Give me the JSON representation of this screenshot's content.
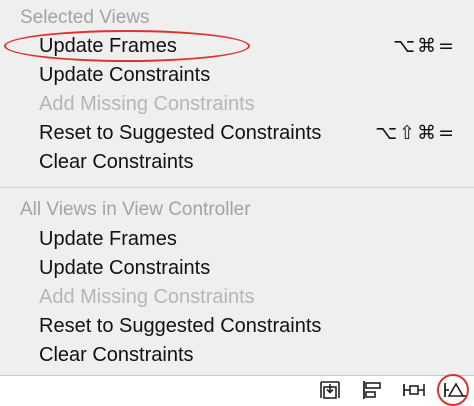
{
  "menu": {
    "selected_views": {
      "header": "Selected Views",
      "items": [
        {
          "label": "Update Frames",
          "shortcut": "⌥⌘=",
          "enabled": true
        },
        {
          "label": "Update Constraints",
          "shortcut": "",
          "enabled": true
        },
        {
          "label": "Add Missing Constraints",
          "shortcut": "",
          "enabled": false
        },
        {
          "label": "Reset to Suggested Constraints",
          "shortcut": "⌥⇧⌘=",
          "enabled": true
        },
        {
          "label": "Clear Constraints",
          "shortcut": "",
          "enabled": true
        }
      ]
    },
    "all_views": {
      "header": "All Views in View Controller",
      "items": [
        {
          "label": "Update Frames",
          "enabled": true
        },
        {
          "label": "Update Constraints",
          "enabled": true
        },
        {
          "label": "Add Missing Constraints",
          "enabled": false
        },
        {
          "label": "Reset to Suggested Constraints",
          "enabled": true
        },
        {
          "label": "Clear Constraints",
          "enabled": true
        }
      ]
    }
  },
  "toolbar": {
    "buttons": [
      {
        "icon": "update-frames-icon"
      },
      {
        "icon": "align-icon"
      },
      {
        "icon": "pin-icon"
      },
      {
        "icon": "resolve-auto-layout-issues-icon"
      }
    ]
  },
  "colors": {
    "annotation": "#e0312c",
    "menu_background": "#efefef",
    "disabled_text": "#b6b6b6",
    "header_text": "#a3a3a3"
  }
}
